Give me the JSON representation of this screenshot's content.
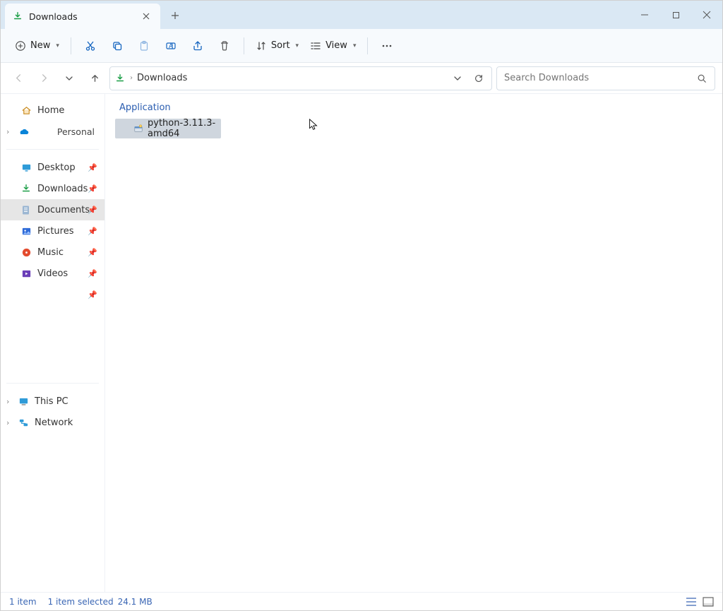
{
  "tab": {
    "title": "Downloads"
  },
  "toolbar": {
    "new_label": "New",
    "sort_label": "Sort",
    "view_label": "View"
  },
  "address": {
    "crumb0": "Downloads"
  },
  "search": {
    "placeholder": "Search Downloads"
  },
  "sidebar": {
    "home": "Home",
    "personal": "Personal",
    "desktop": "Desktop",
    "downloads": "Downloads",
    "documents": "Documents",
    "pictures": "Pictures",
    "music": "Music",
    "videos": "Videos",
    "thispc": "This PC",
    "network": "Network"
  },
  "content": {
    "group0": "Application",
    "files": [
      {
        "name": "python-3.11.3-amd64"
      }
    ]
  },
  "status": {
    "count": "1 item",
    "selected": "1 item selected",
    "size": "24.1 MB"
  }
}
